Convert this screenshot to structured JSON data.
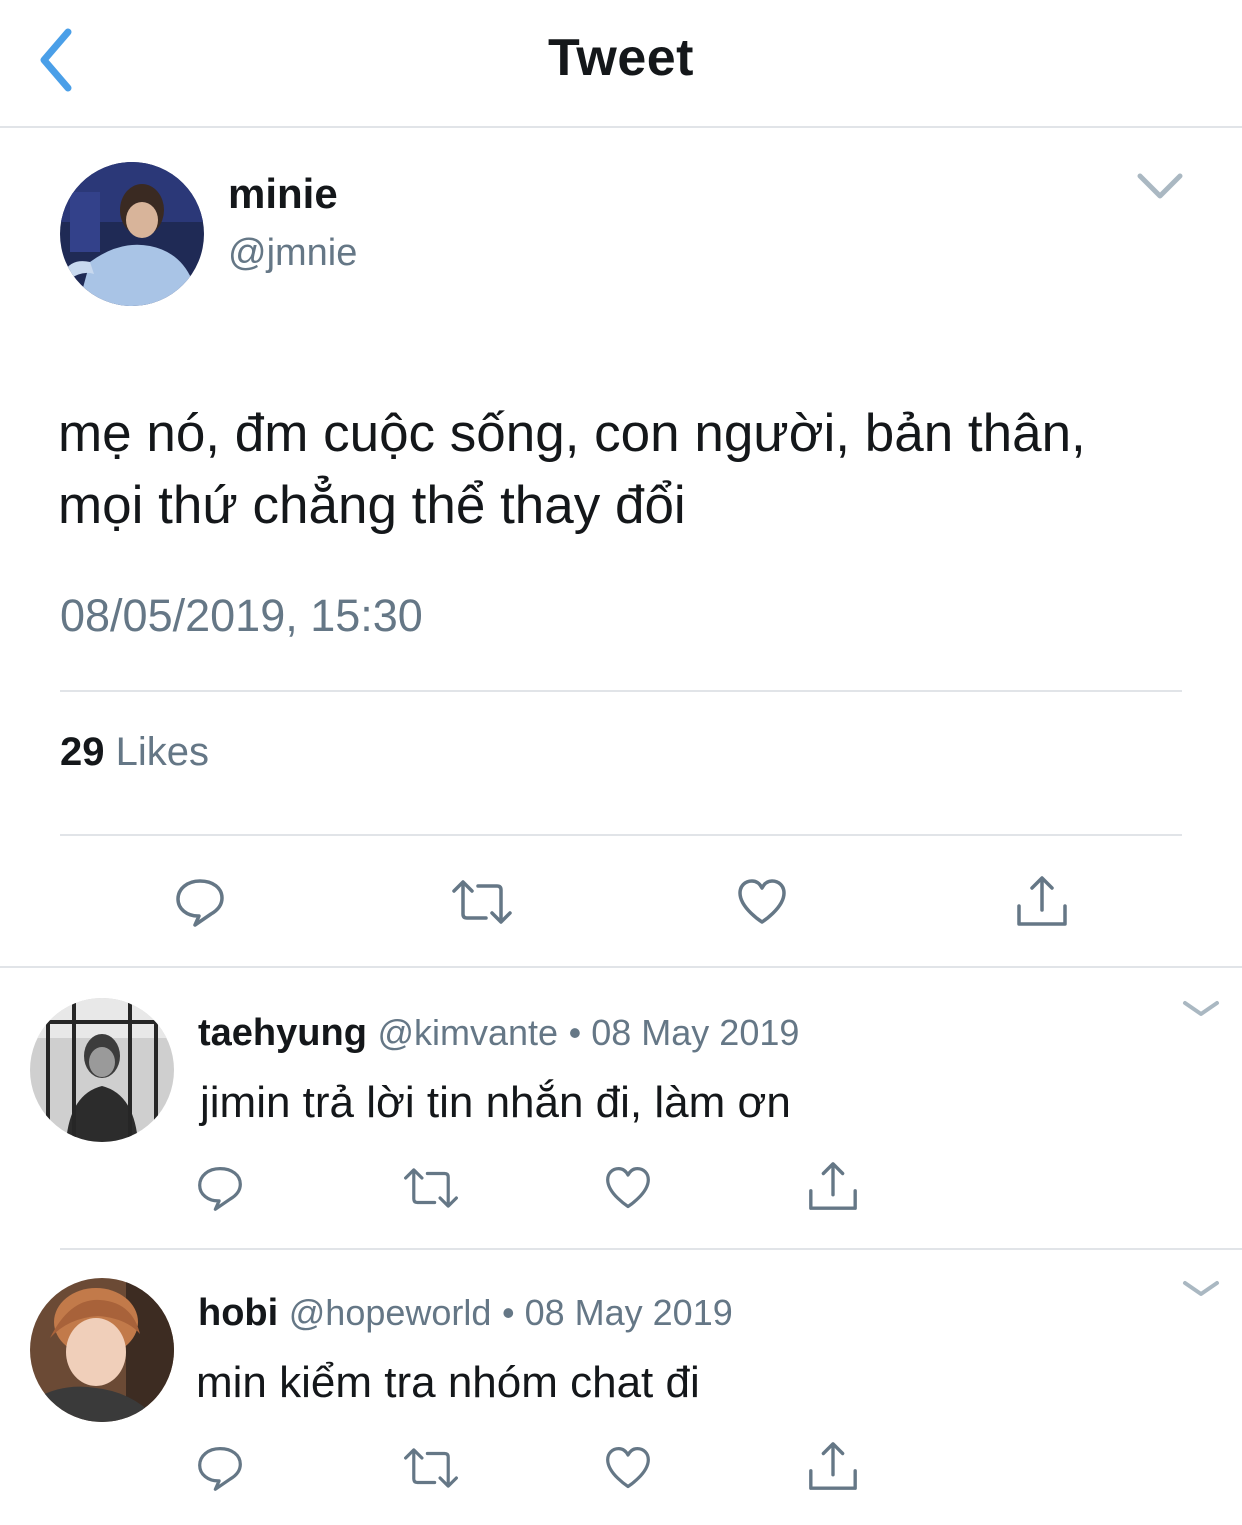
{
  "header": {
    "title": "Tweet"
  },
  "tweet": {
    "author": {
      "name": "minie",
      "handle": "@jmnie"
    },
    "text_lines": [
      "mẹ nó, đm cuộc sống, con người, bản thân,",
      "mọi thứ chẳng thể thay đổi"
    ],
    "timestamp": "08/05/2019, 15:30",
    "likes_count": "29",
    "likes_label": "Likes"
  },
  "replies": [
    {
      "name": "taehyung",
      "handle": "@kimvante",
      "date": "• 08 May 2019",
      "text": "jimin trả lời tin nhắn đi, làm ơn"
    },
    {
      "name": "hobi",
      "handle": "@hopeworld",
      "date": "• 08 May 2019",
      "text": "min kiểm tra nhóm chat đi"
    }
  ],
  "icons": {
    "back": "chevron-left-icon",
    "more": "chevron-down-icon",
    "reply": "speech-bubble-icon",
    "retweet": "retweet-icon",
    "like": "heart-icon",
    "share": "share-icon"
  },
  "colors": {
    "accent": "#4a9fe8",
    "secondary_text": "#657786",
    "primary_text": "#14171a",
    "divider": "#e1e4e8",
    "icon": "#657786"
  }
}
